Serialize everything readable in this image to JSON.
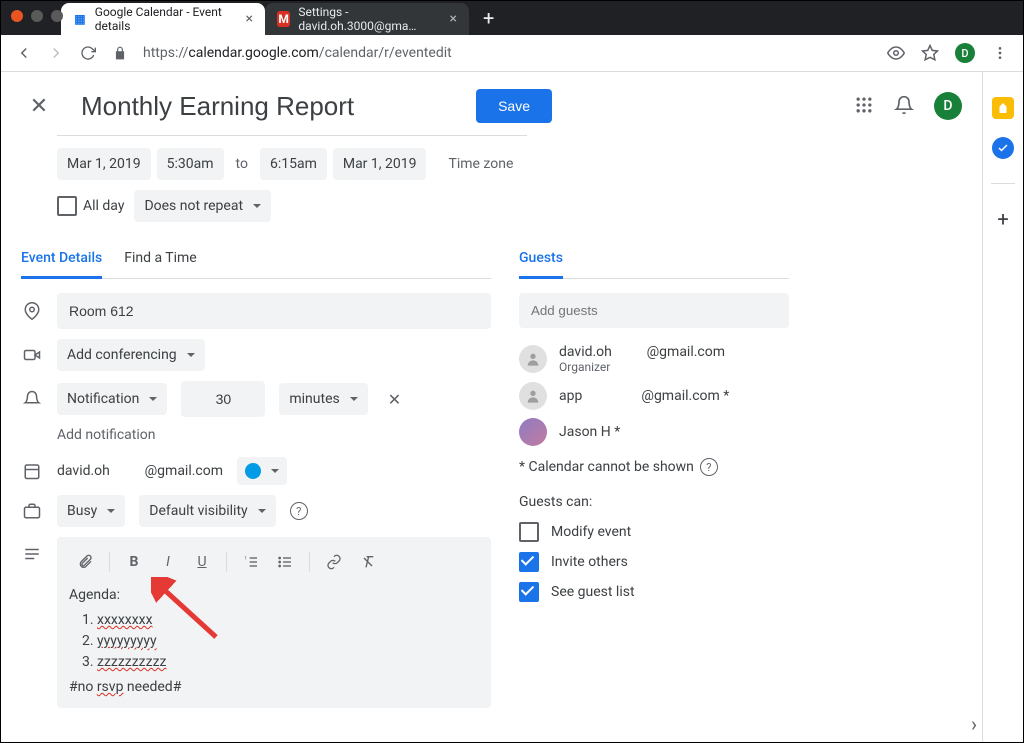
{
  "browser": {
    "tabs": [
      {
        "title": "Google Calendar - Event details",
        "active": true
      },
      {
        "title": "Settings - david.oh.3000@gma…",
        "active": false
      }
    ],
    "url_prefix": "https://",
    "url_host": "calendar.google.com",
    "url_path": "/calendar/r/eventedit",
    "avatar_letter": "D"
  },
  "header": {
    "title": "Monthly Earning Report",
    "save": "Save",
    "avatar_letter": "D"
  },
  "datetime": {
    "start_date": "Mar 1, 2019",
    "start_time": "5:30am",
    "to": "to",
    "end_time": "6:15am",
    "end_date": "Mar 1, 2019",
    "timezone": "Time zone",
    "allday": "All day",
    "repeat": "Does not repeat"
  },
  "tabs": {
    "details": "Event Details",
    "findtime": "Find a Time"
  },
  "details": {
    "location": "Room 612",
    "conferencing": "Add conferencing",
    "notif_type": "Notification",
    "notif_value": "30",
    "notif_unit": "minutes",
    "add_notification": "Add notification",
    "calendar_owner": "david.oh          @gmail.com",
    "busy": "Busy",
    "visibility": "Default visibility"
  },
  "description": {
    "heading": "Agenda:",
    "items": [
      "xxxxxxxx",
      "yyyyyyyyy",
      "zzzzzzzzzz"
    ],
    "footer": "#no rsvp needed#"
  },
  "guests": {
    "tab": "Guests",
    "placeholder": "Add guests",
    "list": [
      {
        "name": "david.oh          @gmail.com",
        "sub": "Organizer"
      },
      {
        "name": "app                 @gmail.com *",
        "sub": ""
      },
      {
        "name": "Jason H *",
        "sub": ""
      }
    ],
    "note": "* Calendar cannot be shown",
    "perms_label": "Guests can:",
    "perms": [
      {
        "label": "Modify event",
        "checked": false
      },
      {
        "label": "Invite others",
        "checked": true
      },
      {
        "label": "See guest list",
        "checked": true
      }
    ]
  }
}
